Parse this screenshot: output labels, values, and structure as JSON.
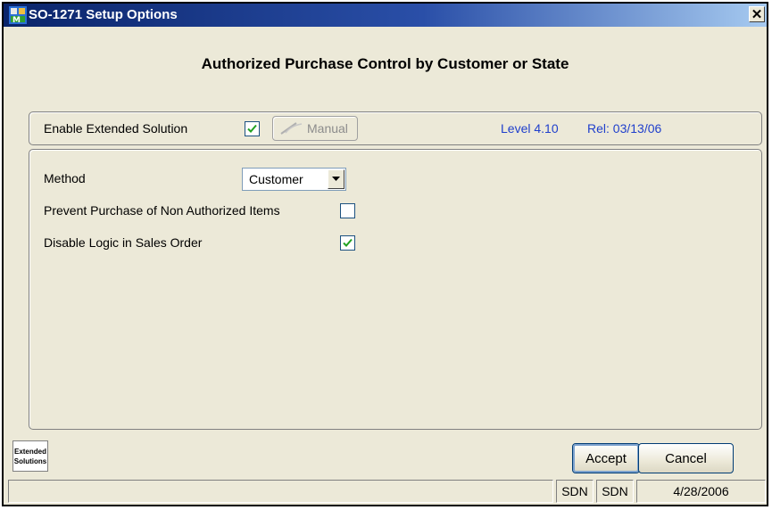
{
  "window": {
    "title": "SO-1271 Setup Options",
    "close_glyph": "✕"
  },
  "heading": "Authorized Purchase Control by Customer or State",
  "enable_panel": {
    "enable_label": "Enable Extended Solution",
    "enable_checked": true,
    "manual_label": "Manual",
    "level": "Level 4.10",
    "release": "Rel: 03/13/06"
  },
  "options": {
    "method_label": "Method",
    "method_value": "Customer",
    "prevent_label": "Prevent Purchase of Non Authorized Items",
    "prevent_checked": false,
    "disable_label": "Disable Logic in Sales Order",
    "disable_checked": true
  },
  "footer": {
    "logo_line1": "Extended",
    "logo_line2": "Solutions",
    "accept_label": "Accept",
    "cancel_label": "Cancel"
  },
  "statusbar": {
    "company": "SDN",
    "user": "SDN",
    "date": "4/28/2006"
  },
  "icons": {
    "app": "app-icon",
    "check": "checkmark-icon",
    "manual": "manual-wand-icon",
    "dropdown": "dropdown-arrow-icon"
  },
  "colors": {
    "titlebar": "#0a246a",
    "face": "#ece9d8",
    "link_blue": "#1f3fcc",
    "check_green": "#21a121"
  }
}
